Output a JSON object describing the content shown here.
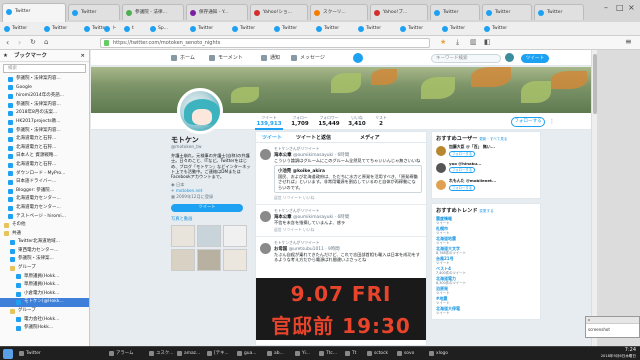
{
  "browser": {
    "tabs": [
      {
        "label": "Twitter"
      },
      {
        "label": "Twitter"
      },
      {
        "label": "参議院 - 法律..."
      },
      {
        "label": "保存通知 - Y..."
      },
      {
        "label": "Yahoo!ショ..."
      },
      {
        "label": "スクーリ..."
      },
      {
        "label": "Yahoo!ブ..."
      },
      {
        "label": "Twitter"
      },
      {
        "label": "Twitter"
      },
      {
        "label": "Twitter"
      }
    ],
    "url": "https://twitter.com/motoken_senoto_nights",
    "bookmarks": [
      "Twitter",
      "Twitter",
      "Twitter",
      "ト",
      "t",
      "Sp...",
      "Twitter",
      "Twitter",
      "Twitter",
      "Twitter",
      "Twitter",
      "Twitter",
      "Twitter",
      "Twitter"
    ]
  },
  "sidebar": {
    "title": "ブックマーク",
    "search_placeholder": "検索",
    "items": [
      {
        "label": "参議院・法律案内容...",
        "type": "page"
      },
      {
        "label": "Google",
        "type": "page"
      },
      {
        "label": "hiromi2014年の英語...",
        "type": "page"
      },
      {
        "label": "参議院・法律案内容...",
        "type": "page"
      },
      {
        "label": "2018年8月の法案...",
        "type": "page"
      },
      {
        "label": "HK2017projects教...",
        "type": "page"
      },
      {
        "label": "参議院・法律案内容...",
        "type": "page"
      },
      {
        "label": "北海道電力と石狩...",
        "type": "page"
      },
      {
        "label": "北海道電力と石狩...",
        "type": "page"
      },
      {
        "label": "日本人と 資源戦略...",
        "type": "page"
      },
      {
        "label": "北海道電力と石狩...",
        "type": "page"
      },
      {
        "label": "ダウンロード - MyPro...",
        "type": "page"
      },
      {
        "label": "日本語ドライバー...",
        "type": "page"
      },
      {
        "label": "Blogger: 参議院...",
        "type": "page"
      },
      {
        "label": "北海道電力センター...",
        "type": "page"
      },
      {
        "label": "北海道電力センター...",
        "type": "page"
      },
      {
        "label": "テストページ - hiromi...",
        "type": "page"
      },
      {
        "label": "その他",
        "type": "folder"
      },
      {
        "label": "共通",
        "type": "folder"
      },
      {
        "label": "Twitter北海道地域...",
        "type": "page"
      },
      {
        "label": "東西電力センター...",
        "type": "page"
      },
      {
        "label": "参議院・法律案...",
        "type": "page"
      },
      {
        "label": "グループ",
        "type": "folder"
      },
      {
        "label": "草原議員(Hokk...",
        "type": "page"
      },
      {
        "label": "草原議員(Hokk...",
        "type": "page"
      },
      {
        "label": "小倉電力(Hokk...",
        "type": "page"
      },
      {
        "label": "モトケン(@Hokk...",
        "type": "page",
        "selected": true
      },
      {
        "label": "グループ",
        "type": "folder"
      },
      {
        "label": "電力会社(Hokk...",
        "type": "page"
      },
      {
        "label": "参議院Hokk...",
        "type": "page"
      }
    ]
  },
  "twitter": {
    "nav": {
      "home": "ホーム",
      "moments": "モーメント",
      "notifications": "通知",
      "messages": "メッセージ",
      "search_placeholder": "キーワード検索",
      "tweet": "ツイート"
    },
    "stats": [
      {
        "label": "ツイート",
        "value": "139,913"
      },
      {
        "label": "フォロー",
        "value": "1,709"
      },
      {
        "label": "フォロワー",
        "value": "15,449"
      },
      {
        "label": "いいね",
        "value": "3,410"
      },
      {
        "label": "リスト",
        "value": "2"
      }
    ],
    "follow_label": "フォローする",
    "profile": {
      "name": "モトケン",
      "handle": "@motoken_tw",
      "bio": "弁護士崩れ。元検事の弁護士(自称)の弁護士。日々のこと、ITなど。Twitterをはじめ、ブログ「モトケン」などインターネット上でも活動中。ご連絡はDMまたはFacebookアカウントまで。",
      "location": "日本",
      "link": "motoken.net",
      "joined": "2009年12月に登録",
      "tweet_to": "ツイート",
      "media": "写真と動画"
    },
    "timeline": {
      "tabs": [
        "ツイート",
        "ツイートと返信",
        "メディア"
      ],
      "tweets": [
        {
          "context": "モトケンさんがリツイート",
          "name": "海本公章",
          "handle": "@oumikimasayuki · 6時間",
          "text": "こういう論調はグルームにこのグルーム全然見ててちゃいいんじゃ無さいいね",
          "quote_name": "小池晃 @koike_akira",
          "quote_text": "国民、および北海道政府は、ただちに水力と原発を活用すべき、「原発稼働させれば」といいます。非常用電源を割応しているのと自体が再稼動にならいのです。",
          "actions": "返信  リツイート  いいね"
        },
        {
          "context": "モトケンさんがリツイート",
          "name": "海本公章",
          "handle": "@oumikimasayuki · 6時間",
          "text": "不信を未含を指摘していまんよ、惑ラ",
          "actions": "返信  リツイート  いいね"
        },
        {
          "context": "モトケンさんがリツイート",
          "name": "お母国",
          "handle": "@uretsubu1011 · 9時間",
          "text": "たぶん自殺が乗れてきたんだけど、これで志田部首相も輸入は日本を成功をするような考え方だから電源ばれ間違いぶさっとね",
          "actions": ""
        }
      ],
      "poster_line1": "9.07 FRI",
      "poster_line2": "官邸前 19:30"
    },
    "suggestions": {
      "title": "おすすめユーザー",
      "refresh": "更新 · すべて見る",
      "users": [
        {
          "name": "加藤大臣 @「百」 無い...",
          "follow": "フォローする"
        },
        {
          "name": "yoo @hinaku...",
          "follow": "フォローする"
        },
        {
          "name": "れもんた @mobilenet...",
          "follow": "フォローする"
        }
      ]
    },
    "trends": {
      "title": "おすすめトレンド",
      "change": "変更する",
      "items": [
        {
          "name": "震度情報",
          "count": "ツイート"
        },
        {
          "name": "札幌市",
          "count": "ツイート"
        },
        {
          "name": "北海道地震",
          "count": "ツイート"
        },
        {
          "name": "北海道大文字",
          "count": "8,768件のツイート"
        },
        {
          "name": "台風21号",
          "count": "ツイート"
        },
        {
          "name": "ベスト4",
          "count": "7,400件のツイート"
        },
        {
          "name": "北海道電力",
          "count": "8,300件のツイート"
        },
        {
          "name": "泊原発",
          "count": "ツイート"
        },
        {
          "name": "#地震",
          "count": "ツイート"
        },
        {
          "name": "北海道大停電",
          "count": "ツイート"
        }
      ]
    }
  },
  "popup": {
    "title": "x",
    "text": "screenshot"
  },
  "taskbar": {
    "items": [
      "Twitter",
      "アラーム",
      "ユスク...",
      "amaz...",
      "[テキ...",
      "gua...",
      "ab...",
      "Yi...",
      "Ttc...",
      "Tt",
      "sctock",
      "sovo",
      "xlogo"
    ],
    "time": "7:24",
    "date": "2018年9月6日木曜日"
  }
}
